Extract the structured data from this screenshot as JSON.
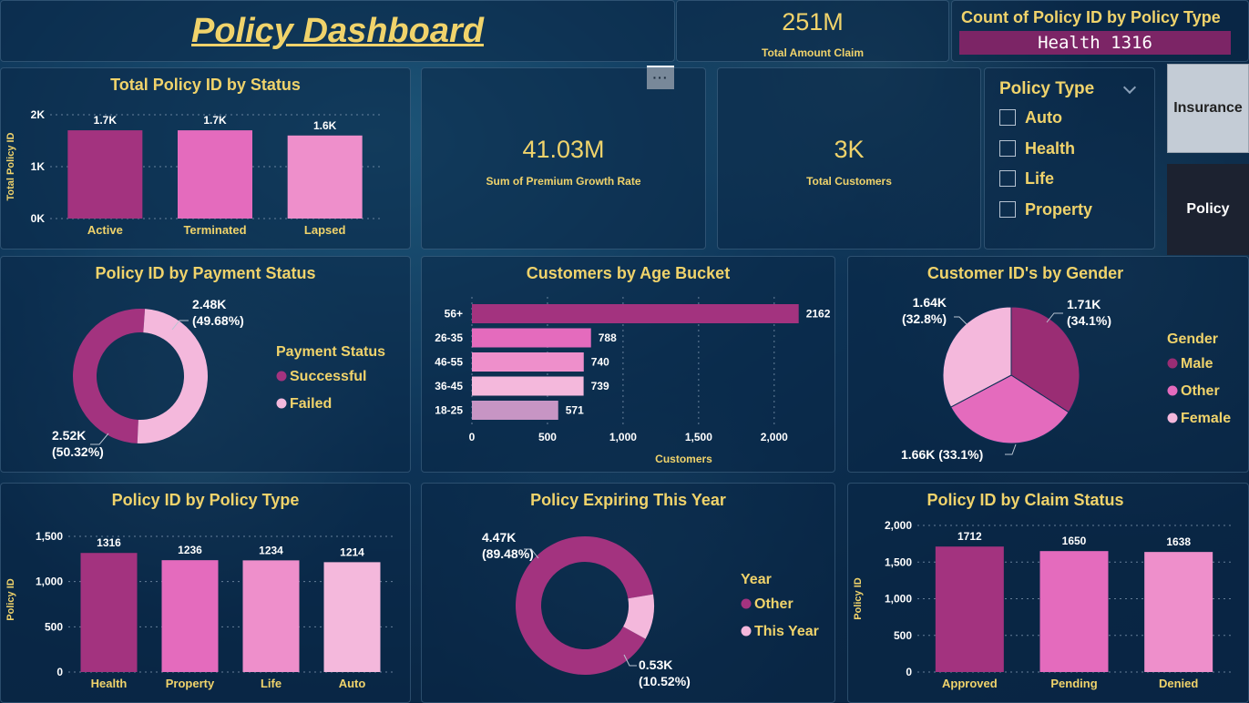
{
  "header": {
    "title": "Policy Dashboard"
  },
  "kpis": {
    "total_amount_claim": {
      "value": "251M",
      "label": "Total Amount Claim"
    },
    "premium_growth": {
      "value": "41.03M",
      "label": "Sum of Premium Growth Rate"
    },
    "total_customers": {
      "value": "3K",
      "label": "Total Customers"
    }
  },
  "policy_type_card": {
    "title": "Count of Policy ID by Policy Type",
    "value": "Health 1316"
  },
  "slicer": {
    "title": "Policy Type",
    "items": [
      "Auto",
      "Health",
      "Life",
      "Property"
    ]
  },
  "nav": {
    "insurance": "Insurance",
    "policy": "Policy"
  },
  "more_label": "···",
  "colors": {
    "gold": "#f0d36b",
    "pink1": "#a3337f",
    "pink2": "#e46bbd",
    "pink3": "#ee8fcb",
    "pink4": "#f4b8dc",
    "pink5": "#c795c4"
  },
  "chart_data": [
    {
      "id": "status",
      "type": "bar",
      "title": "Total Policy ID by Status",
      "ylabel": "Total Policy ID",
      "categories": [
        "Active",
        "Terminated",
        "Lapsed"
      ],
      "values": [
        1700,
        1700,
        1600
      ],
      "labels": [
        "1.7K",
        "1.7K",
        "1.6K"
      ],
      "ylim": [
        0,
        2000
      ],
      "yticks": [
        0,
        1000,
        2000
      ],
      "yticklabels": [
        "0K",
        "1K",
        "2K"
      ]
    },
    {
      "id": "payment",
      "type": "pie",
      "title": "Policy ID by Payment Status",
      "legend_title": "Payment Status",
      "categories": [
        "Successful",
        "Failed"
      ],
      "values": [
        2520,
        2480
      ],
      "labels": [
        [
          "2.52K",
          "(50.32%)"
        ],
        [
          "2.48K",
          "(49.68%)"
        ]
      ]
    },
    {
      "id": "age",
      "type": "bar",
      "title": "Customers by Age Bucket",
      "xlabel": "Customers",
      "categories": [
        "56+",
        "26-35",
        "46-55",
        "36-45",
        "18-25"
      ],
      "values": [
        2162,
        788,
        740,
        739,
        571
      ],
      "xlim": [
        0,
        2200
      ],
      "xticks": [
        0,
        500,
        1000,
        1500,
        2000
      ],
      "xticklabels": [
        "0",
        "500",
        "1,000",
        "1,500",
        "2,000"
      ]
    },
    {
      "id": "gender",
      "type": "pie",
      "title": "Customer ID's by Gender",
      "legend_title": "Gender",
      "categories": [
        "Male",
        "Other",
        "Female"
      ],
      "values": [
        1710,
        1660,
        1640
      ],
      "labels": [
        [
          "1.71K",
          "(34.1%)"
        ],
        [
          "1.66K (33.1%)"
        ],
        [
          "1.64K",
          "(32.8%)"
        ]
      ]
    },
    {
      "id": "ptype",
      "type": "bar",
      "title": "Policy ID by Policy Type",
      "ylabel": "Policy ID",
      "categories": [
        "Health",
        "Property",
        "Life",
        "Auto"
      ],
      "values": [
        1316,
        1236,
        1234,
        1214
      ],
      "ylim": [
        0,
        1600
      ],
      "yticks": [
        0,
        500,
        1000,
        1500
      ],
      "yticklabels": [
        "0",
        "500",
        "1,000",
        "1,500"
      ]
    },
    {
      "id": "expiring",
      "type": "pie",
      "title": "Policy Expiring This Year",
      "legend_title": "Year",
      "categories": [
        "Other",
        "This Year"
      ],
      "values": [
        4470,
        530
      ],
      "labels": [
        [
          "4.47K",
          "(89.48%)"
        ],
        [
          "0.53K",
          "(10.52%)"
        ]
      ]
    },
    {
      "id": "claim",
      "type": "bar",
      "title": "Policy ID by Claim Status",
      "ylabel": "Policy ID",
      "categories": [
        "Approved",
        "Pending",
        "Denied"
      ],
      "values": [
        1712,
        1650,
        1638
      ],
      "ylim": [
        0,
        2000
      ],
      "yticks": [
        0,
        500,
        1000,
        1500,
        2000
      ],
      "yticklabels": [
        "0",
        "500",
        "1,000",
        "1,500",
        "2,000"
      ]
    }
  ]
}
